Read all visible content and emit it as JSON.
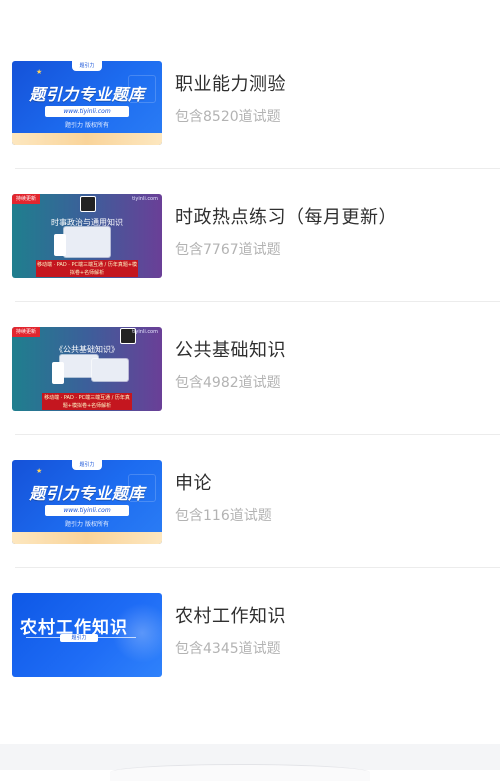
{
  "items": [
    {
      "title": "职业能力测验",
      "subtitle": "包含8520道试题",
      "thumb": {
        "logo": "题引力",
        "headline": "题引力专业题库",
        "url": "www.tiyinli.com",
        "note": "题引力 版权所有"
      }
    },
    {
      "title": "时政热点练习（每月更新）",
      "subtitle": "包含7767道试题",
      "thumb": {
        "tag": "持续更新",
        "site": "tiyinli.com",
        "heading": "时事政治与通用知识",
        "bar": "移动端 · PAD · PC端三端互通 / 历年真题+模拟卷+名师解析"
      }
    },
    {
      "title": "公共基础知识",
      "subtitle": "包含4982道试题",
      "thumb": {
        "tag": "持续更新",
        "site": "tiyinli.com",
        "heading": "《公共基础知识》",
        "bar": "移动端 · PAD · PC端三端互通 / 历年真题+模拟卷+名师解析"
      }
    },
    {
      "title": "申论",
      "subtitle": "包含116道试题",
      "thumb": {
        "logo": "题引力",
        "headline": "题引力专业题库",
        "url": "www.tiyinli.com",
        "note": "题引力 版权所有"
      }
    },
    {
      "title": "农村工作知识",
      "subtitle": "包含4345道试题",
      "thumb": {
        "headline": "农村工作知识",
        "button": "题引力"
      }
    }
  ],
  "colors": {
    "title": "#2f2f2f",
    "subtitle": "#b3b3b3",
    "divider": "#ececec",
    "brand_blue": "#1552d8"
  }
}
